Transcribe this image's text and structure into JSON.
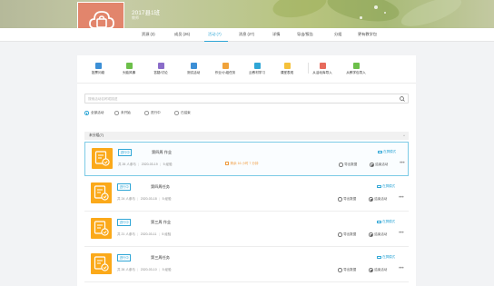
{
  "course": {
    "title": "2017县1班",
    "subtitle": "教师"
  },
  "tabs": [
    {
      "label": "资源 (3)",
      "active": false
    },
    {
      "label": "成员 (26)",
      "active": false
    },
    {
      "label": "活动 (7)",
      "active": true
    },
    {
      "label": "消息 (27)",
      "active": false
    },
    {
      "label": "详情",
      "active": false
    },
    {
      "label": "导出/报告",
      "active": false
    },
    {
      "label": "分组",
      "active": false
    },
    {
      "label": "更有教学包",
      "active": false
    }
  ],
  "toolbar": [
    {
      "label": "投票问卷",
      "icon": "vote-icon",
      "color": "#3c8fd6"
    },
    {
      "label": "头脑风暴",
      "icon": "brainstorm-icon",
      "color": "#6cbf4a"
    },
    {
      "label": "答疑/讨论",
      "icon": "discussion-icon",
      "color": "#8a6cc9"
    },
    {
      "label": "测试活动",
      "icon": "test-icon",
      "color": "#3c8fd6"
    },
    {
      "label": "作业/小组任务",
      "icon": "homework-icon",
      "color": "#f0a23a"
    },
    {
      "label": "云教材学习",
      "icon": "textbook-icon",
      "color": "#2fa6d6"
    },
    {
      "label": "课堂表现",
      "icon": "performance-icon",
      "color": "#f5c13b"
    },
    {
      "label": "从活动库导入",
      "icon": "import-library-icon",
      "color": "#e76a5c"
    },
    {
      "label": "从教学包导入",
      "icon": "import-package-icon",
      "color": "#6cbf4a"
    }
  ],
  "search": {
    "placeholder": "搜索活动名称或描述"
  },
  "filters": [
    {
      "label": "全部活动",
      "selected": true
    },
    {
      "label": "未开始",
      "selected": false
    },
    {
      "label": "进行中",
      "selected": false
    },
    {
      "label": "已结束",
      "selected": false
    }
  ],
  "section": {
    "title": "未分组(7)"
  },
  "activities": [
    {
      "status": "进行中",
      "title": "第四周 作业",
      "participants": "共 26 人参与",
      "date": "2020-03-19",
      "score": "5 经验",
      "remaining": "剩余 16 小时 7 分钟",
      "top_link": "在屏模式",
      "export": "导出数据",
      "end": "结束活动",
      "active": true
    },
    {
      "status": "进行中",
      "title": "第四周任务",
      "participants": "共 24 人参与",
      "date": "2020-03-18",
      "score": "5 经验",
      "remaining": "",
      "top_link": "在屏模式",
      "export": "导出数据",
      "end": "结束活动",
      "active": false
    },
    {
      "status": "进行中",
      "title": "第三周 作业",
      "participants": "共 21 人参与",
      "date": "2020-03-11",
      "score": "5 经验",
      "remaining": "",
      "top_link": "在屏模式",
      "export": "导出数据",
      "end": "结束活动",
      "active": false
    },
    {
      "status": "进行中",
      "title": "第三周任务",
      "participants": "共 26 人参与",
      "date": "2020-03-10",
      "score": "5 经验",
      "remaining": "",
      "top_link": "在屏模式",
      "export": "导出数据",
      "end": "结束活动",
      "active": false
    }
  ],
  "colors": {
    "accent": "#2fa6d6",
    "thumb": "#fba91a",
    "logo": "#e2856c",
    "warning": "#f09a3c"
  }
}
